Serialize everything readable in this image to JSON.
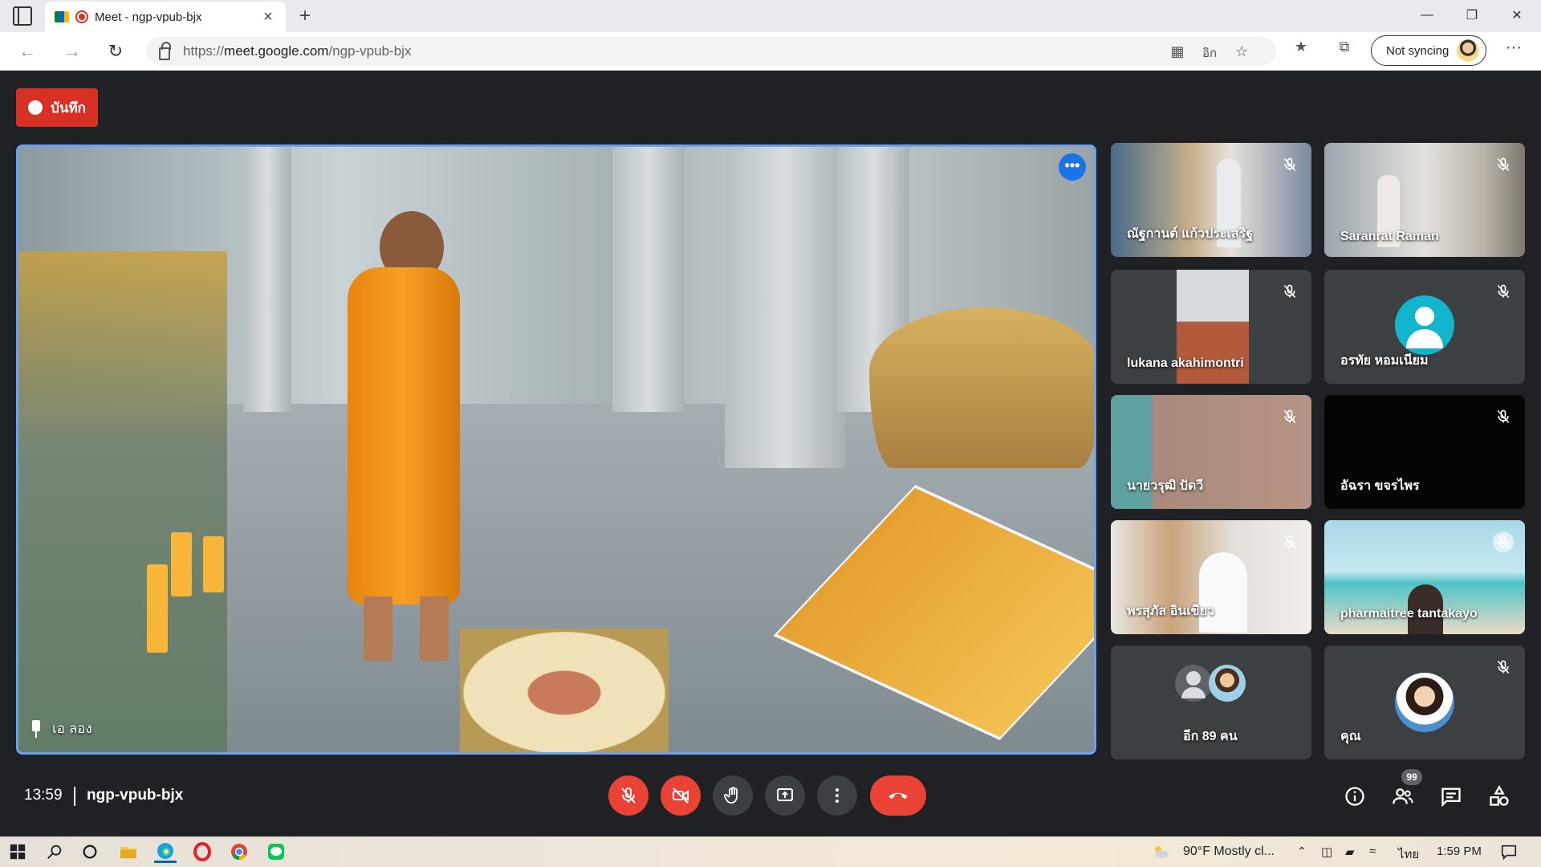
{
  "browser": {
    "tab_title": "Meet - ngp-vpub-bjx",
    "url_prefix": "https://",
    "url_domain": "meet.google.com",
    "url_path": "/ngp-vpub-bjx",
    "sync_label": "Not syncing",
    "new_tab": "+",
    "close": "×",
    "more": "···",
    "minimize": "—",
    "restore": "❐",
    "window_close": "✕"
  },
  "meet": {
    "record_label": "บันทึก",
    "main_presenter": "เอ ลอง",
    "main_more": "•••",
    "tiles": [
      {
        "name": "ณัฐกานต์ แก้วประเสริฐ",
        "muted": true
      },
      {
        "name": "Saranrat Raman",
        "muted": true
      },
      {
        "name": "lukana akahimontri",
        "muted": true
      },
      {
        "name": "อรทัย หอมเนียม",
        "muted": true
      },
      {
        "name": "นายวรุฒิ ปัดวี",
        "muted": true
      },
      {
        "name": "อัฉรา ขจรไพร",
        "muted": true
      },
      {
        "name": "พรสุภัส อินเขียว",
        "muted": true
      },
      {
        "name": "pharmaitree tantakayo",
        "muted": true
      },
      {
        "name": "อีก 89 คน",
        "muted": false
      },
      {
        "name": "คุณ",
        "muted": true
      }
    ],
    "time": "13:59",
    "meeting_code": "ngp-vpub-bjx",
    "participants_badge": "99"
  },
  "taskbar": {
    "weather": "90°F  Mostly cl...",
    "language": "ไทย",
    "time": "1:59 PM"
  },
  "colors": {
    "meet_bg": "#202124",
    "record_red": "#d93025",
    "control_red": "#ea4335",
    "control_gray": "#3c4043",
    "active_border": "#6aa0f5",
    "avatar_teal": "#12b5cb"
  }
}
